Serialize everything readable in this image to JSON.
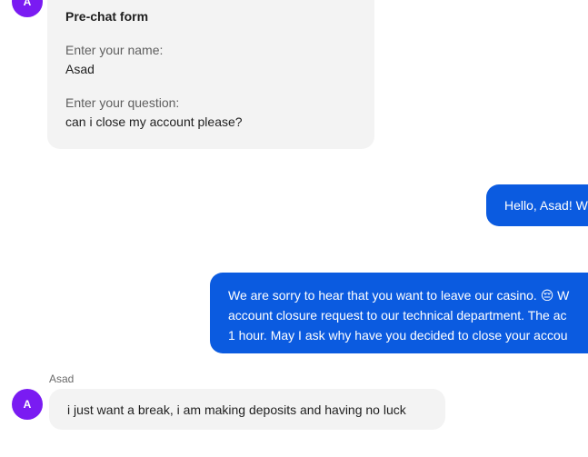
{
  "avatar_initial": "A",
  "prechat_form": {
    "title": "Pre-chat form",
    "name_label": "Enter your name:",
    "name_value": "Asad",
    "question_label": "Enter your question:",
    "question_value": "can i close my account please?"
  },
  "agent_messages": [
    {
      "text": "Hello, Asad! W"
    },
    {
      "lines": [
        "We are sorry to hear that you want to leave our casino. 😔 W",
        "account closure request to our technical department. The ac",
        "1 hour. May I ask why have you decided to close your accou"
      ]
    }
  ],
  "user_message": {
    "sender": "Asad",
    "text": "i just want a break, i am making deposits and having no luck"
  }
}
